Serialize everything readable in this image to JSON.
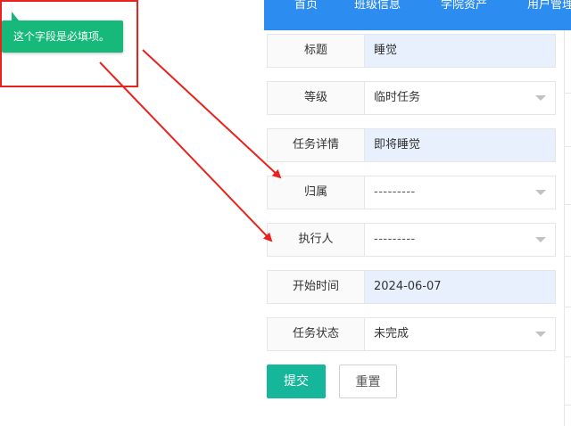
{
  "nav": {
    "items": [
      "首页",
      "班级信息",
      "学院资产",
      "用户管理"
    ]
  },
  "tooltip": {
    "message": "这个字段是必填项。"
  },
  "form": {
    "title_label": "标题",
    "title_value": "睡觉",
    "level_label": "等级",
    "level_value": "临时任务",
    "detail_label": "任务详情",
    "detail_value": "即将睡觉",
    "owner_label": "归属",
    "owner_value": "---------",
    "assignee_label": "执行人",
    "assignee_value": "---------",
    "start_label": "开始时间",
    "start_value": "2024-06-07",
    "status_label": "任务状态",
    "status_value": "未完成"
  },
  "buttons": {
    "submit": "提交",
    "reset": "重置"
  },
  "colors": {
    "nav_bg": "#2d8cf0",
    "tooltip_bg": "#16b97a",
    "submit_bg": "#16b69a",
    "annotation_red": "#e8231e",
    "autofill_bg": "#e8f0fe"
  }
}
